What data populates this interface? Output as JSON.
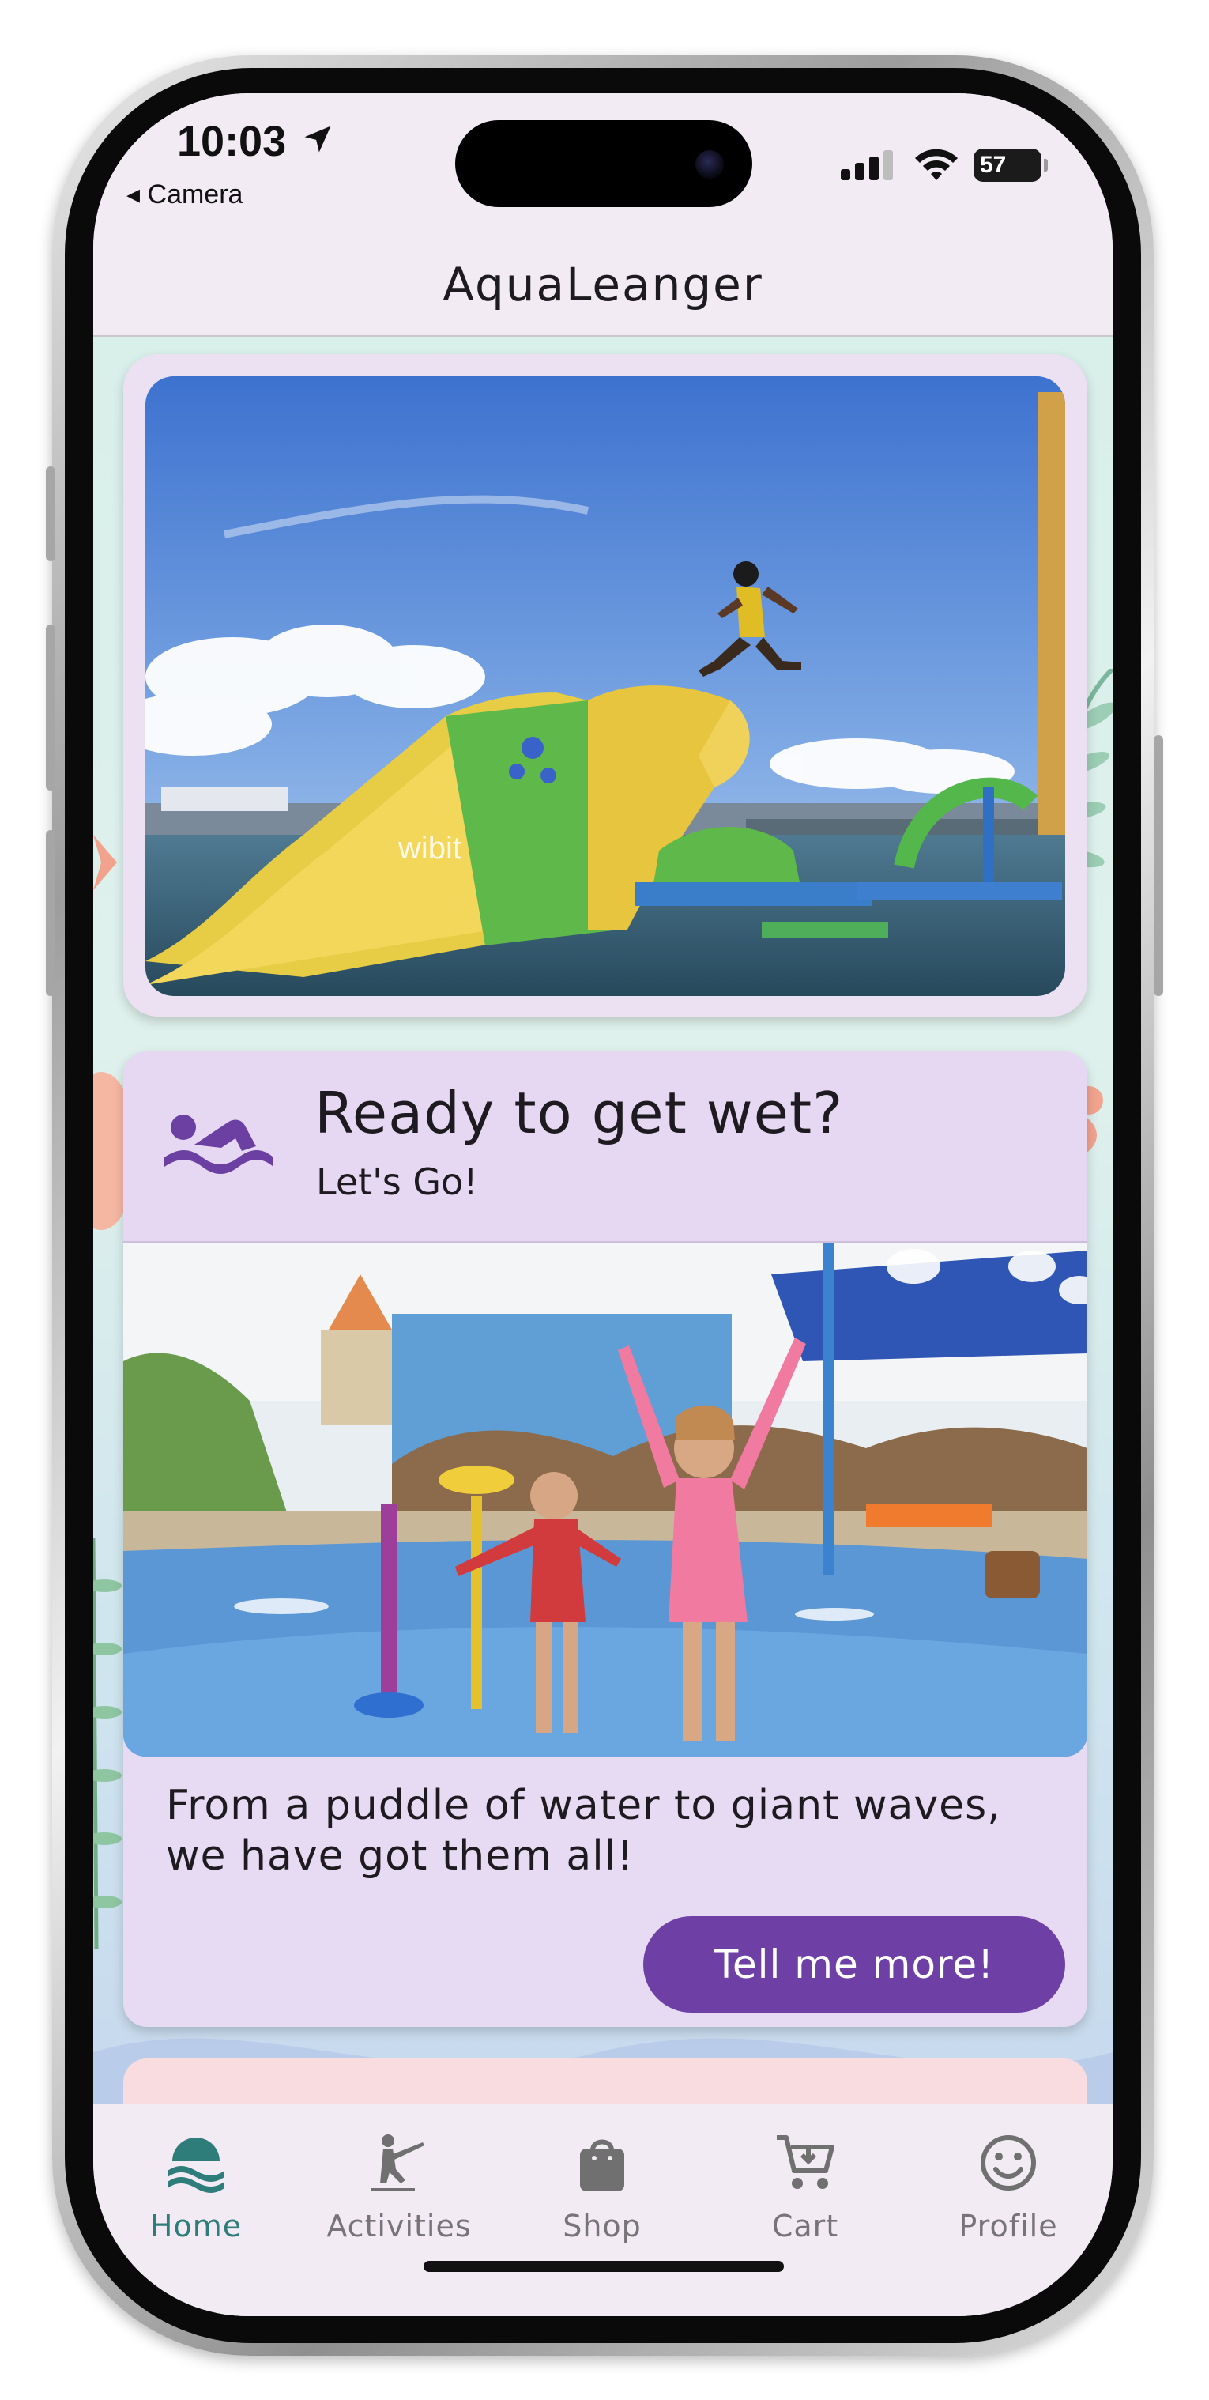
{
  "status_bar": {
    "time": "10:03",
    "back_label": "◂ Camera",
    "battery": "57"
  },
  "app_bar": {
    "title": "AquaLeanger"
  },
  "hero": {
    "image_label": "wibit"
  },
  "promo": {
    "title": "Ready to get wet?",
    "subtitle": "Let's Go!",
    "description": "From a puddle of water to giant waves, we have got them all!",
    "button_label": "Tell me more!"
  },
  "bottom_nav": {
    "items": [
      {
        "label": "Home",
        "icon": "waves-icon",
        "active": true
      },
      {
        "label": "Activities",
        "icon": "water-ski-icon",
        "active": false
      },
      {
        "label": "Shop",
        "icon": "shopping-bag-icon",
        "active": false
      },
      {
        "label": "Cart",
        "icon": "cart-icon",
        "active": false
      },
      {
        "label": "Profile",
        "icon": "smiley-icon",
        "active": false
      }
    ]
  },
  "colors": {
    "accent": "#6e40a6",
    "active_nav": "#2e7d7b",
    "card_bg": "#e7daf3",
    "surface": "#f2ebf4"
  }
}
